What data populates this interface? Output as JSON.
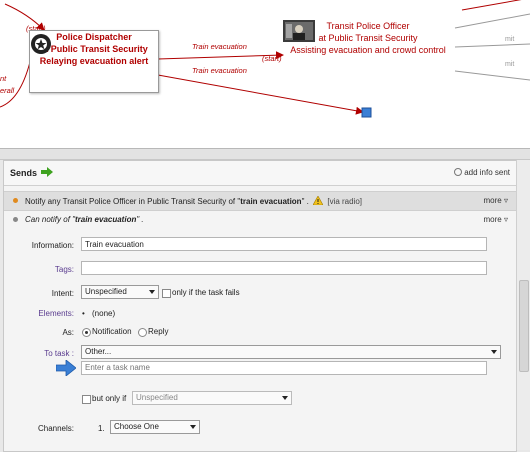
{
  "diagram": {
    "dispatcher": {
      "lines": [
        "Police Dispatcher",
        "at Public Transit Security",
        "Relaying evacuation alert"
      ]
    },
    "officer": {
      "lines": [
        "Transit Police Officer",
        "at Public Transit Security",
        "Assisting evacuation and crowd control"
      ]
    },
    "labels": {
      "start_left": "(start)",
      "start_mid": "(start)",
      "flow_top": "Train evacuation",
      "flow_bottom": "Train evacuation",
      "side_nt": "nt",
      "side_erall": "erall",
      "mit_1": "mit",
      "mit_2": "mit"
    }
  },
  "sends": {
    "title": "Sends",
    "add_info": "add info sent",
    "flow1": {
      "prefix": "Notify any Transit Police Officer in Public Transit Security of \"",
      "name": "train evacuation",
      "suffix": "\" .",
      "via": "[via radio]",
      "more": "more"
    },
    "flow2": {
      "prefix": "Can notify of \"",
      "name": "train evacuation",
      "suffix": "\" .",
      "more": "more"
    }
  },
  "form": {
    "information_label": "Information:",
    "information_value": "Train evacuation",
    "tags_label": "Tags:",
    "tags_value": "",
    "intent_label": "Intent:",
    "intent_value": "Unspecified",
    "intent_fail_label": "only if the task fails",
    "elements_label": "Elements:",
    "elements_value": "(none)",
    "as_label": "As:",
    "as_notification": "Notification",
    "as_reply": "Reply",
    "to_task_label": "To task :",
    "to_task_value": "Other...",
    "task_name_placeholder": "Enter a task name",
    "but_only_if_label": "but only if",
    "but_only_if_value": "Unspecified",
    "channels_label": "Channels:",
    "channel_index": "1.",
    "channel_value": "Choose One"
  },
  "colors": {
    "flow_red": "#b00000",
    "link_purple": "#5a3c8f",
    "arrow_blue": "#3a7fd5",
    "arrow_green": "#3ea21f"
  }
}
